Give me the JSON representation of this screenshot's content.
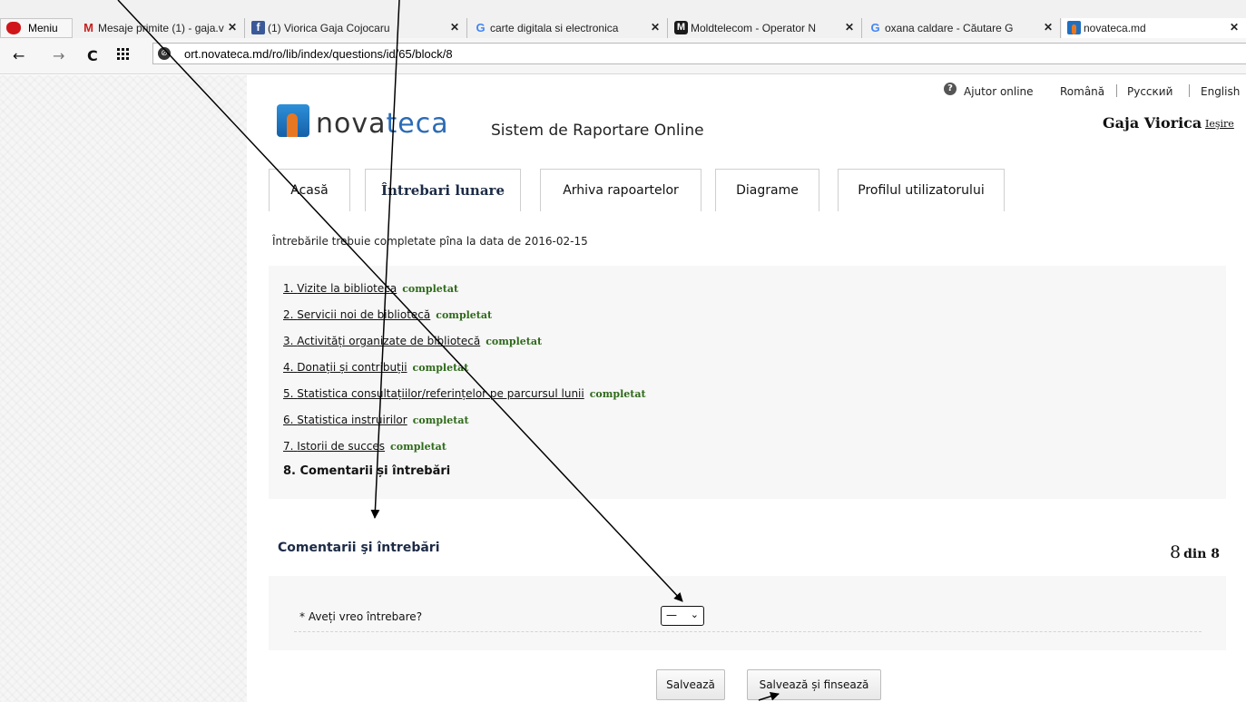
{
  "browser": {
    "menu_label": "Meniu",
    "tabs": [
      {
        "title": "Mesaje primite (1) - gaja.v",
        "icon": "gmail-icon",
        "glyph": "M"
      },
      {
        "title": "(1) Viorica Gaja Cojocaru",
        "icon": "facebook-icon",
        "glyph": "f"
      },
      {
        "title": "carte digitala si electronica",
        "icon": "google-icon",
        "glyph": "G"
      },
      {
        "title": "Moldtelecom - Operator N",
        "icon": "moldtelecom-icon",
        "glyph": "M"
      },
      {
        "title": "oxana caldare - Căutare G",
        "icon": "google-icon",
        "glyph": "G"
      },
      {
        "title": "novateca.md",
        "icon": "novateca-icon",
        "glyph": ""
      }
    ],
    "close_glyph": "✕",
    "url": "ort.novateca.md/ro/lib/index/questions/id/65/block/8"
  },
  "header": {
    "help_label": "Ajutor online",
    "languages": [
      "Română",
      "Русский",
      "English"
    ],
    "logo_part1": "nova",
    "logo_part2": "teca",
    "site_title": "Sistem de Raportare Online",
    "user_name": "Gaja Viorica",
    "logout_label": "Ieşire"
  },
  "nav": {
    "tabs": [
      "Acasă",
      "Întrebari lunare",
      "Arhiva rapoartelor",
      "Diagrame",
      "Profilul utilizatorului"
    ],
    "active_index": 1
  },
  "main": {
    "deadline_text": "Întrebările trebuie completate pîna la data de 2016-02-15",
    "questions": [
      {
        "num": "1.",
        "label": "Vizite la biblioteca",
        "status": "completat"
      },
      {
        "num": "2.",
        "label": "Servicii noi de bibliotecă",
        "status": "completat"
      },
      {
        "num": "3.",
        "label": "Activități organizate de bibliotecă",
        "status": "completat"
      },
      {
        "num": "4.",
        "label": "Donații și contribuții",
        "status": "completat"
      },
      {
        "num": "5.",
        "label": "Statistica consultațiilor/referințelor pe parcursul lunii",
        "status": "completat"
      },
      {
        "num": "6.",
        "label": "Statistica instruirilor",
        "status": "completat"
      },
      {
        "num": "7.",
        "label": "Istorii de succes",
        "status": "completat"
      }
    ],
    "current_question": "8. Comentarii și întrebări",
    "section_title": "Comentarii şi întrebări",
    "counter_num": "8",
    "counter_rest": "din 8",
    "form_label": "* Aveți vreo întrebare?",
    "select_value": "—",
    "save_label": "Salvează",
    "save_finish_label": "Salvează și finsează"
  },
  "colors": {
    "status_green": "#2e6a1a",
    "heading_navy": "#1c2b46",
    "brand_blue": "#2b6bb5",
    "brand_orange": "#e87722"
  }
}
